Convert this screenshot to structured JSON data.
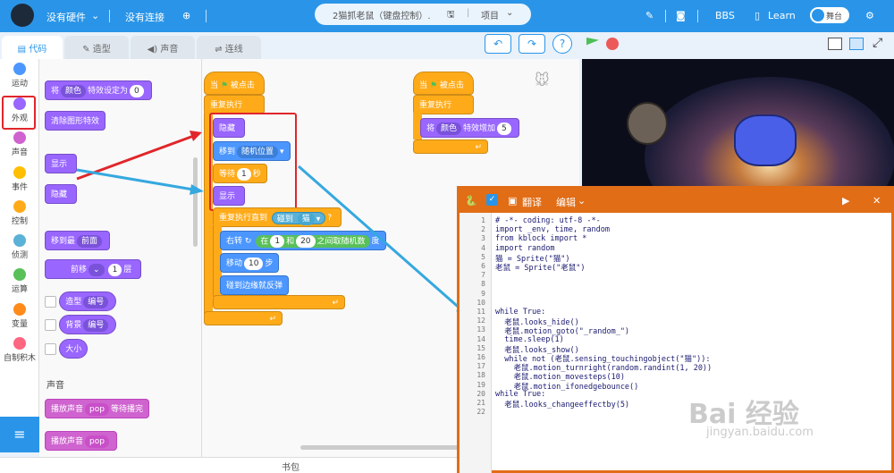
{
  "topbar": {
    "hardware": "没有硬件",
    "connection": "没有连接",
    "project_name": "2猫抓老鼠（键盘控制）.",
    "project_menu": "项目",
    "bbs": "BBS",
    "learn": "Learn",
    "stage_toggle": "舞台"
  },
  "tabs": {
    "code": "代码",
    "costume": "造型",
    "sound": "声音",
    "connect": "连线"
  },
  "categories": [
    {
      "label": "运动",
      "color": "#4c97ff"
    },
    {
      "label": "外观",
      "color": "#9966ff"
    },
    {
      "label": "声音",
      "color": "#cf63cf"
    },
    {
      "label": "事件",
      "color": "#ffbf00"
    },
    {
      "label": "控制",
      "color": "#ffab19"
    },
    {
      "label": "侦测",
      "color": "#5cb1d6"
    },
    {
      "label": "运算",
      "color": "#59c059"
    },
    {
      "label": "变量",
      "color": "#ff8c1a"
    },
    {
      "label": "自制积木",
      "color": "#ff6680"
    }
  ],
  "palette_blocks": {
    "set_effect": "将",
    "color_opt": "颜色",
    "set_effect_to": "特效设定为",
    "set_value": "0",
    "clear_effects": "清除图形特效",
    "show": "显示",
    "hide": "隐藏",
    "move_to": "移到最",
    "front": "前面",
    "forward": "前移",
    "layer_value": "1",
    "layer": "层",
    "costume": "造型",
    "number1": "编号",
    "backdrop": "背景",
    "number2": "编号",
    "size": "大小",
    "sound_header": "声音",
    "play_until": "播放声音",
    "pop1": "pop",
    "until_done": "等待播完",
    "play": "播放声音",
    "pop2": "pop"
  },
  "script1": {
    "when_flag": "当",
    "clicked": "被点击",
    "forever": "重复执行",
    "hide": "隐藏",
    "goto": "移到",
    "random_pos": "随机位置",
    "wait": "等待",
    "wait_val": "1",
    "seconds": "秒",
    "show": "显示",
    "repeat_until": "重复执行直到",
    "touching": "碰到",
    "cat": "猫",
    "turn": "右转",
    "pick": "在",
    "from": "1",
    "and": "和",
    "to": "20",
    "between": "之间取随机数",
    "degrees": "度",
    "move": "移动",
    "steps_val": "10",
    "steps": "步",
    "bounce": "碰到边缘就反弹"
  },
  "script2": {
    "when_flag": "当",
    "clicked": "被点击",
    "forever": "重复执行",
    "change": "将",
    "color_opt": "颜色",
    "change_by": "特效增加",
    "change_val": "5"
  },
  "editor": {
    "translate": "翻译",
    "edit": "编辑",
    "line_numbers": [
      "1",
      "2",
      "3",
      "4",
      "5",
      "6",
      "7",
      "8",
      "9",
      "10",
      "11",
      "12",
      "13",
      "14",
      "15",
      "16",
      "17",
      "18",
      "19",
      "20",
      "21",
      "22"
    ],
    "lines": [
      "# -*- coding: utf-8 -*-",
      "import _env, time, random",
      "from kblock import *",
      "import random",
      "猫 = Sprite(\"猫\")",
      "老鼠 = Sprite(\"老鼠\")",
      "",
      "",
      "",
      "",
      "while True:",
      "  老鼠.looks_hide()",
      "  老鼠.motion_goto(\"_random_\")",
      "  time.sleep(1)",
      "  老鼠.looks_show()",
      "  while not (老鼠.sensing_touchingobject(\"猫\")):",
      "    老鼠.motion_turnright(random.randint(1, 20))",
      "    老鼠.motion_movesteps(10)",
      "    老鼠.motion_ifonedgebounce()",
      "while True:",
      "  老鼠.looks_changeeffectby(5)",
      ""
    ]
  },
  "bottom": {
    "backpack": "书包"
  },
  "watermark": {
    "text": "Bai 经验",
    "sub": "jingyan.baidu.com"
  },
  "colors": {
    "accent": "#2a95e8",
    "editor_header": "#e16d16",
    "highlight": "#e0262a",
    "arrow_blue": "#35a8e0"
  }
}
